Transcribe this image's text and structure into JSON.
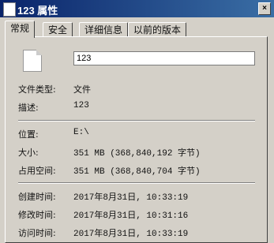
{
  "window": {
    "title": "123 属性"
  },
  "tabs": [
    "常规",
    "安全",
    "详细信息",
    "以前的版本"
  ],
  "general": {
    "file_name": "123",
    "rows": [
      {
        "label": "文件类型:",
        "value": "文件"
      },
      {
        "label": "描述:",
        "value": "123"
      },
      {
        "label": "位置:",
        "value": "E:\\"
      },
      {
        "label": "大小:",
        "value": "351 MB (368,840,192 字节)"
      },
      {
        "label": "占用空间:",
        "value": "351 MB (368,840,704 字节)"
      },
      {
        "label": "创建时间:",
        "value": "2017年8月31日, 10:33:19"
      },
      {
        "label": "修改时间:",
        "value": "2017年8月31日, 10:31:16"
      },
      {
        "label": "访问时间:",
        "value": "2017年8月31日, 10:33:19"
      }
    ]
  }
}
